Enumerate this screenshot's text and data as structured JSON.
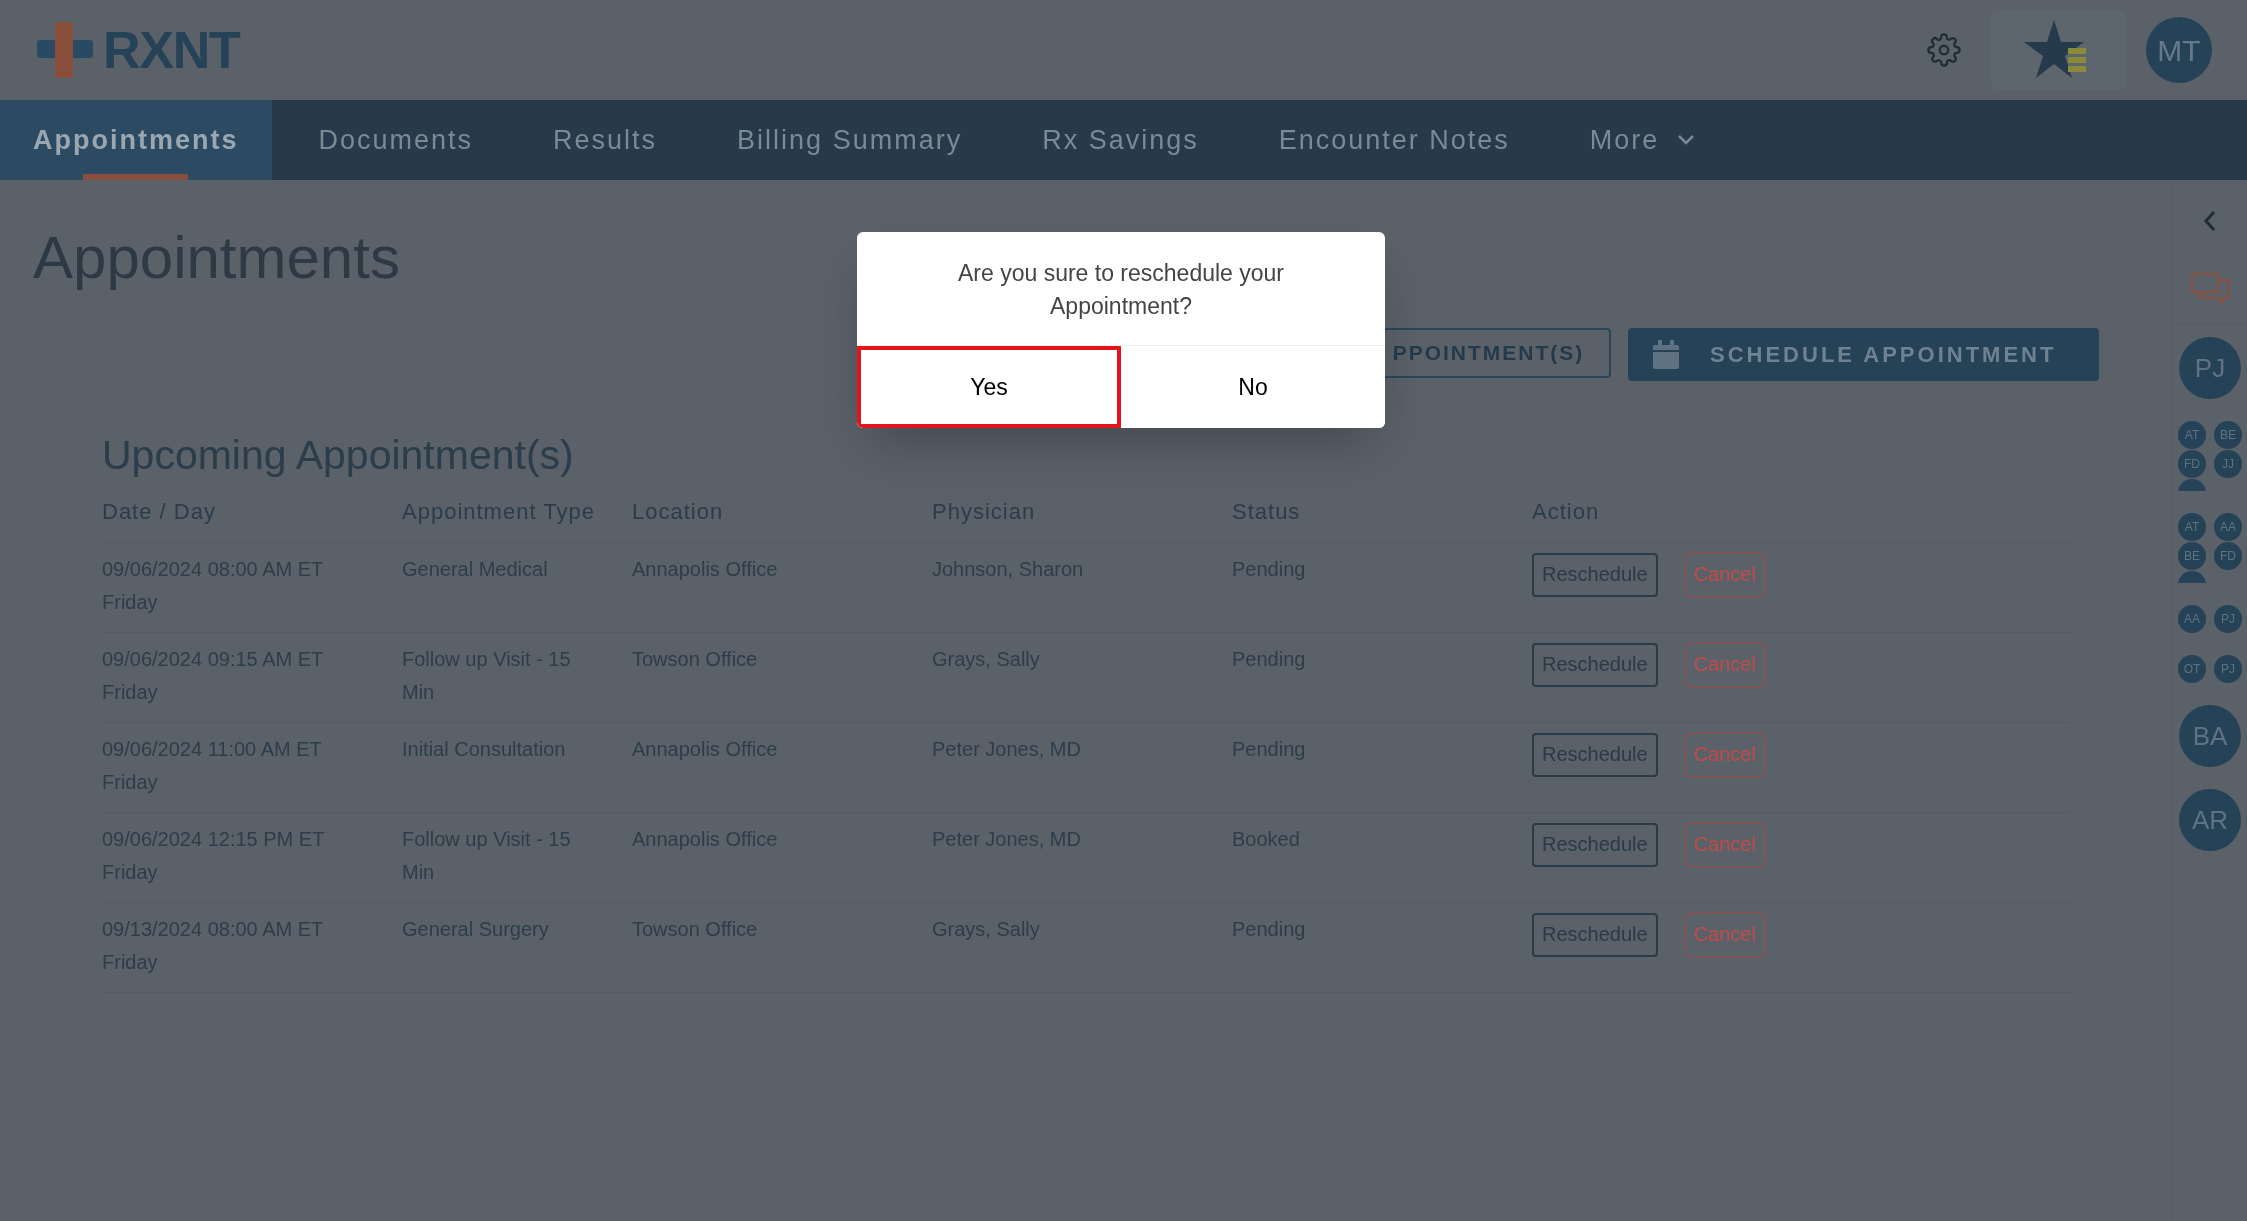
{
  "header": {
    "logo": "RXNT",
    "user_initials": "MT"
  },
  "nav": {
    "tabs": [
      {
        "label": "Appointments",
        "selected": true
      },
      {
        "label": "Documents",
        "selected": false
      },
      {
        "label": "Results",
        "selected": false
      },
      {
        "label": "Billing Summary",
        "selected": false
      },
      {
        "label": "Rx Savings",
        "selected": false
      },
      {
        "label": "Encounter Notes",
        "selected": false
      },
      {
        "label": "More",
        "selected": false,
        "dropdown": true
      }
    ]
  },
  "page_title": "Appointments",
  "actions": [
    {
      "kind": "outline",
      "label": "PPOINTMENT(S)"
    },
    {
      "kind": "primary",
      "label": "SCHEDULE APPOINTMENT"
    }
  ],
  "upcoming": {
    "title": "Upcoming Appointment(s)",
    "columns": [
      "Date / Day",
      "Appointment Type",
      "Location",
      "Physician",
      "Status",
      "Action"
    ],
    "rows": [
      {
        "date": "09/06/2024 08:00 AM ET",
        "day": "Friday",
        "type": "General Medical",
        "location": "Annapolis Office",
        "physician": "Johnson, Sharon",
        "status": "Pending",
        "actions": [
          "Reschedule",
          "Cancel"
        ]
      },
      {
        "date": "09/06/2024 09:15 AM ET",
        "day": "Friday",
        "type": "Follow up Visit - 15 Min",
        "location": "Towson Office",
        "physician": "Grays, Sally",
        "status": "Pending",
        "actions": [
          "Reschedule",
          "Cancel"
        ]
      },
      {
        "date": "09/06/2024 11:00 AM ET",
        "day": "Friday",
        "type": "Initial Consultation",
        "location": "Annapolis Office",
        "physician": "Peter Jones, MD",
        "status": "Pending",
        "actions": [
          "Reschedule",
          "Cancel"
        ]
      },
      {
        "date": "09/06/2024 12:15 PM ET",
        "day": "Friday",
        "type": "Follow up Visit - 15 Min",
        "location": "Annapolis Office",
        "physician": "Peter Jones, MD",
        "status": "Booked",
        "actions": [
          "Reschedule",
          "Cancel"
        ]
      },
      {
        "date": "09/13/2024 08:00 AM ET",
        "day": "Friday",
        "type": "General Surgery",
        "location": "Towson Office",
        "physician": "Grays, Sally",
        "status": "Pending",
        "actions": [
          "Reschedule",
          "Cancel"
        ]
      }
    ]
  },
  "right_sidebar": {
    "groups": [
      {
        "kind": "single",
        "avatars": [
          "PJ"
        ]
      },
      {
        "kind": "cluster",
        "avatars": [
          "AT",
          "BE",
          "FD",
          "JJ"
        ],
        "overflow": true
      },
      {
        "kind": "cluster",
        "avatars": [
          "AT",
          "AA",
          "BE",
          "FD"
        ],
        "overflow": true
      },
      {
        "kind": "cluster",
        "avatars": [
          "AA",
          "PJ"
        ]
      },
      {
        "kind": "cluster",
        "avatars": [
          "OT",
          "PJ"
        ]
      },
      {
        "kind": "single",
        "avatars": [
          "BA"
        ]
      },
      {
        "kind": "single",
        "avatars": [
          "AR"
        ]
      }
    ]
  },
  "dialog": {
    "message": "Are you sure to reschedule your Appointment?",
    "buttons": [
      {
        "label": "Yes",
        "focused": true
      },
      {
        "label": "No",
        "focused": false
      }
    ]
  }
}
